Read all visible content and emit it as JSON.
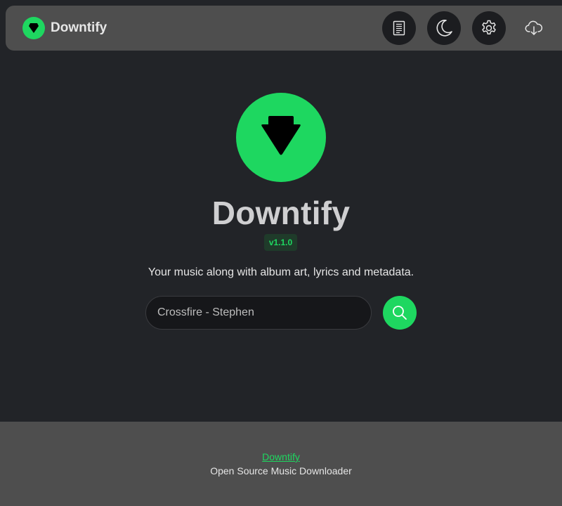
{
  "navbar": {
    "brand_name": "Downtify",
    "buttons": [
      {
        "icon": "document-icon"
      },
      {
        "icon": "moon-icon"
      },
      {
        "icon": "gear-icon"
      },
      {
        "icon": "cloud-download-icon"
      }
    ]
  },
  "main": {
    "title": "Downtify",
    "version": "v1.1.0",
    "tagline": "Your music along with album art, lyrics and metadata.",
    "search": {
      "value": "Crossfire - Stephen",
      "button_icon": "search-icon"
    }
  },
  "footer": {
    "link_text": "Downtify",
    "description": "Open Source Music Downloader"
  },
  "colors": {
    "accent": "#1ed760",
    "background": "#222428",
    "navbar": "#4e4e4e",
    "footer": "#4e4e4e"
  }
}
